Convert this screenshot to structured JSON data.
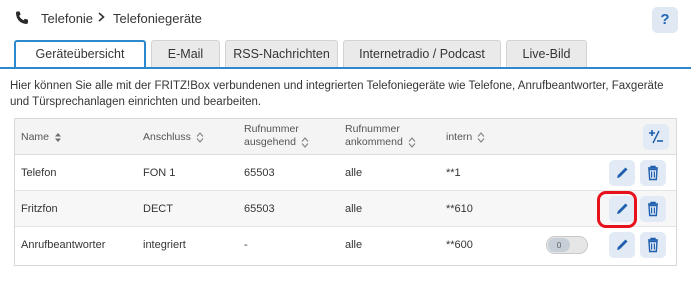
{
  "breadcrumb": {
    "root": "Telefonie",
    "current": "Telefoniegeräte"
  },
  "help_label": "?",
  "tabs": [
    {
      "label": "Geräteübersicht",
      "active": true
    },
    {
      "label": "E-Mail",
      "active": false
    },
    {
      "label": "RSS-Nachrichten",
      "active": false
    },
    {
      "label": "Internetradio / Podcast",
      "active": false
    },
    {
      "label": "Live-Bild",
      "active": false
    }
  ],
  "intro": "Hier können Sie alle mit der FRITZ!Box verbundenen und integrierten Telefoniegeräte wie Telefone, Anrufbeantworter, Faxgeräte und Türsprechanlagen einrichten und bearbeiten.",
  "table": {
    "headers": {
      "name": "Name",
      "anschluss": "Anschluss",
      "ausgehend_1": "Rufnummer",
      "ausgehend_2": "ausgehend",
      "ankommend_1": "Rufnummer",
      "ankommend_2": "ankommend",
      "intern": "intern"
    },
    "rows": [
      {
        "name": "Telefon",
        "anschluss": "FON 1",
        "ausgehend": "65503",
        "ankommend": "alle",
        "intern": "**1"
      },
      {
        "name": "Fritzfon",
        "anschluss": "DECT",
        "ausgehend": "65503",
        "ankommend": "alle",
        "intern": "**610"
      },
      {
        "name": "Anrufbeantworter",
        "anschluss": "integriert",
        "ausgehend": "-",
        "ankommend": "alle",
        "intern": "**600",
        "toggle_label": "0"
      }
    ]
  },
  "colors": {
    "accent": "#2e88cc",
    "icon_blue": "#1f5fae",
    "highlight_red": "#e8121d"
  }
}
